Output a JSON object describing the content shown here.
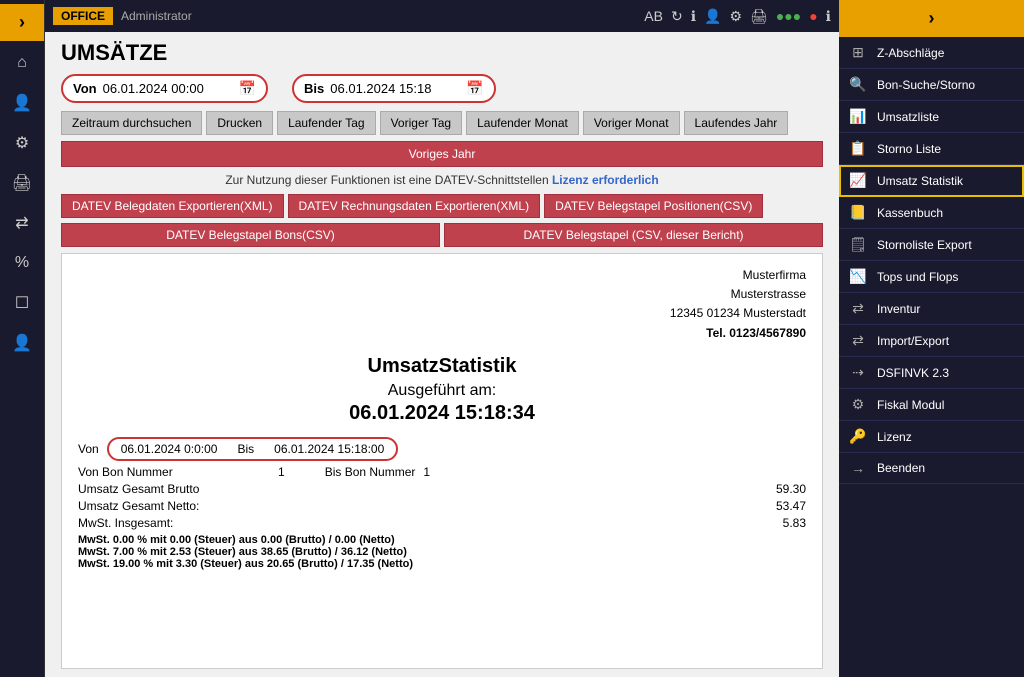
{
  "topbar": {
    "office_label": "OFFICE",
    "admin_label": "Administrator",
    "icons": [
      "AB",
      "↻",
      "ℹ",
      "👤",
      "⚙",
      "🖨",
      "▪▪▪",
      "●",
      "▪",
      "🔴",
      "ℹ"
    ]
  },
  "page": {
    "title": "UMSÄTZE"
  },
  "date_from": {
    "label": "Von",
    "value": "06.01.2024 00:00"
  },
  "date_to": {
    "label": "Bis",
    "value": "06.01.2024 15:18"
  },
  "buttons_row1": [
    "Zeitraum durchsuchen",
    "Drucken",
    "Laufender Tag",
    "Voriger Tag",
    "Laufender Monat",
    "Voriger Monat",
    "Laufendes Jahr"
  ],
  "buttons_row2": [
    "Voriges Jahr"
  ],
  "license_text": "Zur Nutzung dieser Funktionen ist eine DATEV-Schnittstellen",
  "license_link": "Lizenz erforderlich",
  "datev_row1": [
    "DATEV Belegdaten Exportieren(XML)",
    "DATEV Rechnungsdaten Exportieren(XML)",
    "DATEV Belegstapel Positionen(CSV)"
  ],
  "datev_row2": [
    "DATEV Belegstapel Bons(CSV)",
    "DATEV Belegstapel (CSV, dieser Bericht)"
  ],
  "report": {
    "company": "Musterfirma",
    "street": "Musterstrasse",
    "city": "12345 01234 Musterstadt",
    "phone": "Tel. 0123/4567890",
    "title": "UmsatzStatistik",
    "executed_label": "Ausgeführt am:",
    "executed_date": "06.01.2024 15:18:34",
    "von_label": "Von",
    "von_value": "06.01.2024 0:0:00",
    "bis_label": "Bis",
    "bis_value": "06.01.2024 15:18:00",
    "bon_von_label": "Von Bon Nummer",
    "bon_von_value": "1",
    "bon_bis_label": "Bis Bon Nummer",
    "bon_bis_value": "1",
    "brutto_label": "Umsatz Gesamt Brutto",
    "brutto_value": "59.30",
    "netto_label": "Umsatz Gesamt Netto:",
    "netto_value": "53.47",
    "mwst_label": "MwSt. Insgesamt:",
    "mwst_value": "5.83",
    "mwst_lines": [
      "MwSt. 0.00 % mit 0.00 (Steuer) aus 0.00 (Brutto) / 0.00 (Netto)",
      "MwSt. 7.00 % mit 2.53 (Steuer) aus 38.65 (Brutto) / 36.12 (Netto)",
      "MwSt. 19.00 % mit 3.30 (Steuer) aus 20.65 (Brutto) / 17.35 (Netto)"
    ]
  },
  "right_menu": {
    "items": [
      {
        "id": "z-abschlage",
        "icon": "⊞",
        "label": "Z-Abschläge"
      },
      {
        "id": "bon-suche",
        "icon": "🔍",
        "label": "Bon-Suche/Storno"
      },
      {
        "id": "umsatzliste",
        "icon": "📊",
        "label": "Umsatzliste"
      },
      {
        "id": "storno-liste",
        "icon": "📋",
        "label": "Storno Liste"
      },
      {
        "id": "umsatz-statistik",
        "icon": "📈",
        "label": "Umsatz Statistik",
        "active": true
      },
      {
        "id": "kassenbuch",
        "icon": "📒",
        "label": "Kassenbuch"
      },
      {
        "id": "stornoliste-export",
        "icon": "🗒",
        "label": "Stornoliste Export"
      },
      {
        "id": "tops-flops",
        "icon": "📉",
        "label": "Tops und Flops"
      },
      {
        "id": "inventur",
        "icon": "⇄",
        "label": "Inventur"
      },
      {
        "id": "import-export",
        "icon": "⇄",
        "label": "Import/Export"
      },
      {
        "id": "dsfinvk",
        "icon": "⇢",
        "label": "DSFINVK 2.3"
      },
      {
        "id": "fiskal-modul",
        "icon": "⚙",
        "label": "Fiskal Modul"
      },
      {
        "id": "lizenz",
        "icon": "🔑",
        "label": "Lizenz"
      },
      {
        "id": "beenden",
        "icon": "→",
        "label": "Beenden"
      }
    ]
  }
}
